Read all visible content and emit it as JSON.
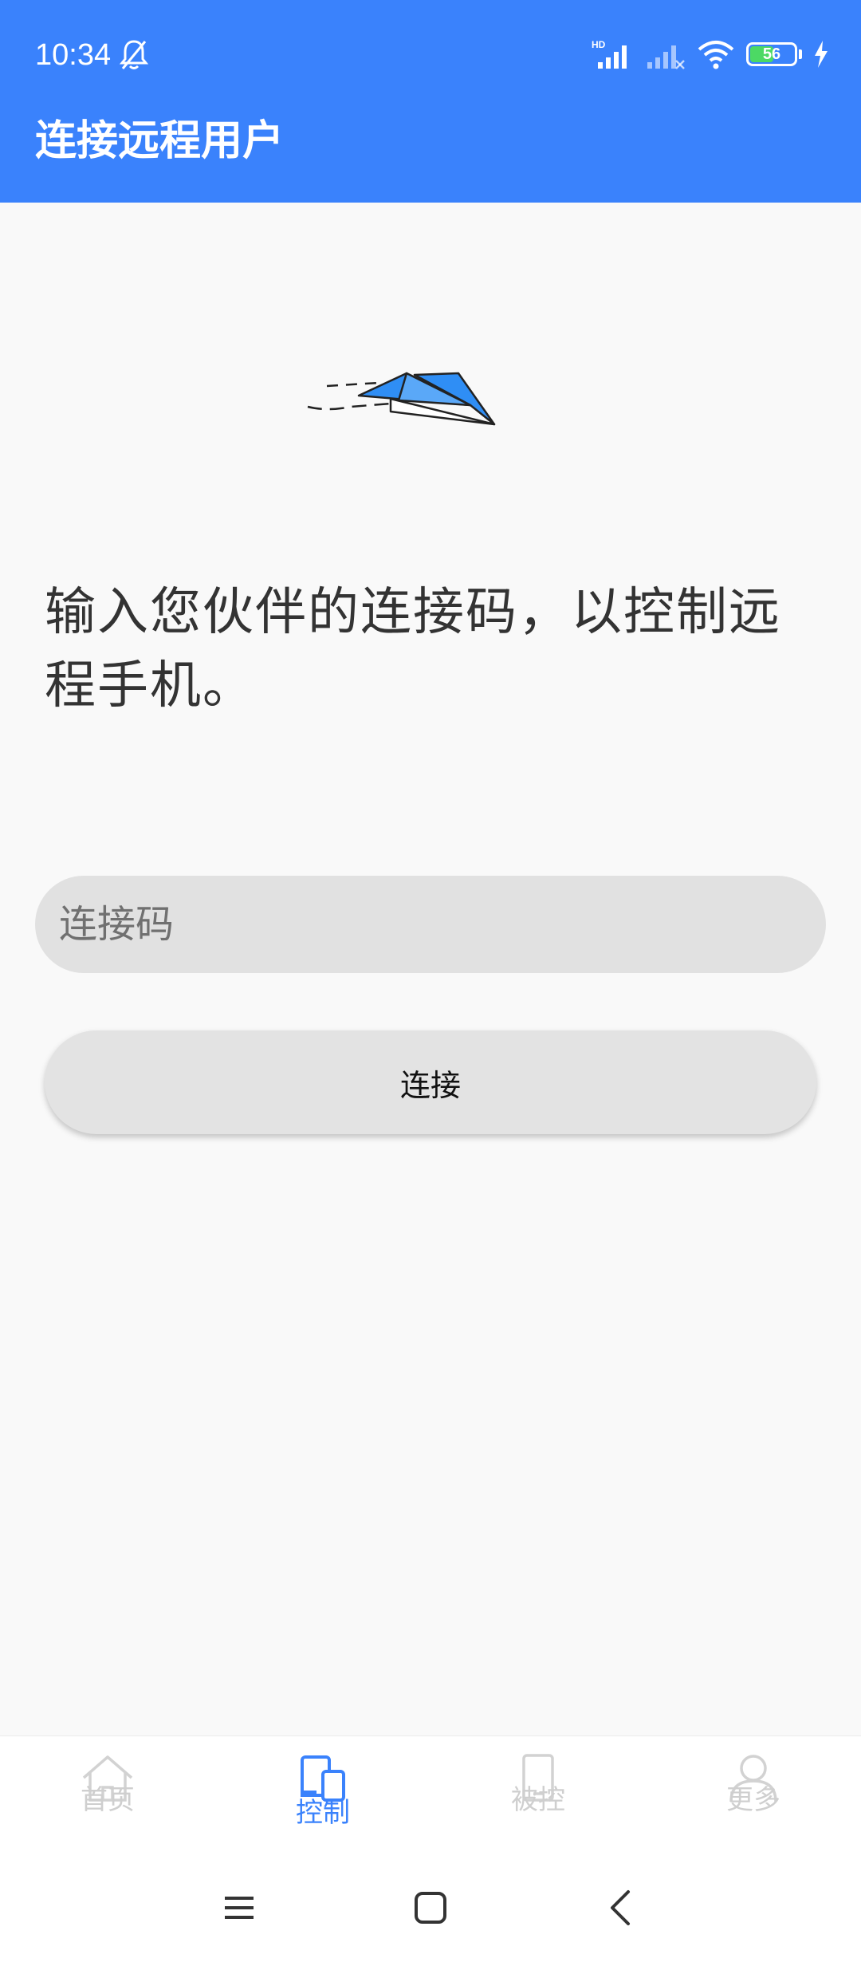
{
  "status_bar": {
    "time": "10:34",
    "battery_level": "56",
    "icons": [
      "bell-off-icon",
      "hd-signal-icon",
      "signal-icon",
      "wifi-icon",
      "battery-icon",
      "charging-icon"
    ]
  },
  "app_bar": {
    "title": "连接远程用户"
  },
  "main": {
    "illustration": "paper-plane-icon",
    "instruction": "输入您伙伴的连接码，以控制远程手机。",
    "code_input": {
      "placeholder": "连接码",
      "value": ""
    },
    "connect_button": "连接"
  },
  "bottom_nav": {
    "items": [
      {
        "label": "首页",
        "icon": "home-icon",
        "active": false
      },
      {
        "label": "控制",
        "icon": "devices-icon",
        "active": true
      },
      {
        "label": "被控",
        "icon": "phone-icon",
        "active": false
      },
      {
        "label": "更多",
        "icon": "person-icon",
        "active": false
      }
    ]
  },
  "system_nav": [
    "menu-icon",
    "home-square-icon",
    "back-icon"
  ],
  "colors": {
    "primary": "#3a82fc",
    "background": "#f9f9f9",
    "inactive": "#cfcfcf"
  }
}
